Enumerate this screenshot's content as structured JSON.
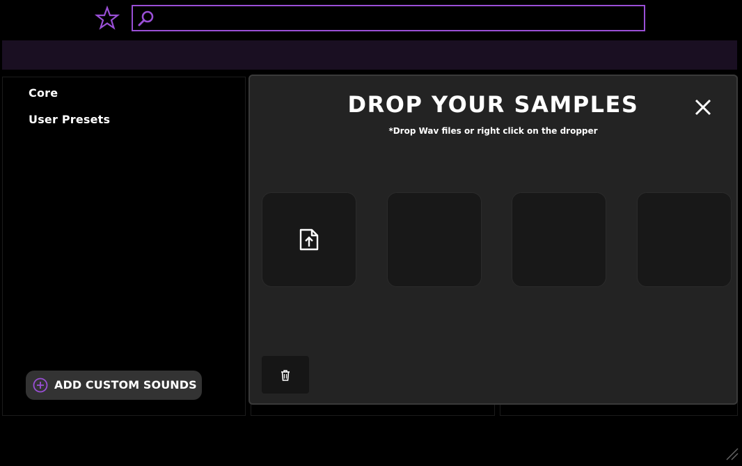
{
  "search": {
    "placeholder": "",
    "value": ""
  },
  "icons": {
    "favorites": "star-icon",
    "search": "search-icon",
    "close": "close-icon",
    "add": "plus-circle-icon",
    "upload": "file-upload-icon",
    "delete": "trash-icon",
    "resize": "resize-grip-icon"
  },
  "colors": {
    "accent": "#9a4fd6",
    "topbar": "#1a0f22",
    "modal_bg": "#232323",
    "slot_bg": "#181818"
  },
  "sidebar": {
    "items": [
      {
        "label": "Core"
      },
      {
        "label": "User Presets"
      }
    ],
    "add_button_label": "ADD CUSTOM SOUNDS"
  },
  "modal": {
    "title": "DROP YOUR SAMPLES",
    "subtitle": "*Drop Wav files or right click on the dropper"
  }
}
